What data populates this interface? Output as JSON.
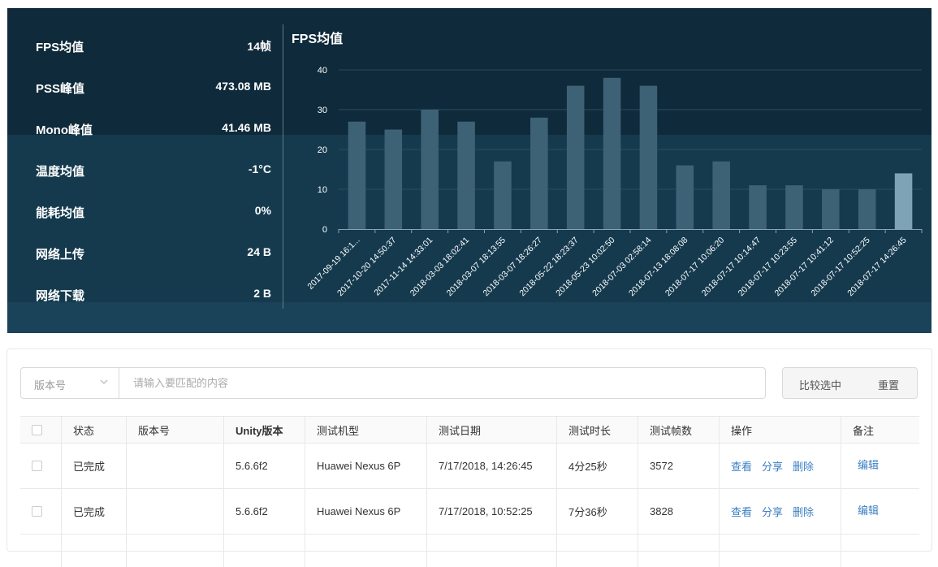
{
  "stats": [
    {
      "label": "FPS均值",
      "value": "14帧"
    },
    {
      "label": "PSS峰值",
      "value": "473.08 MB"
    },
    {
      "label": "Mono峰值",
      "value": "41.46 MB"
    },
    {
      "label": "温度均值",
      "value": "-1°C"
    },
    {
      "label": "能耗均值",
      "value": "0%"
    },
    {
      "label": "网络上传",
      "value": "24 B"
    },
    {
      "label": "网络下载",
      "value": "2 B"
    }
  ],
  "colors": {
    "bar": "#3e6275",
    "bar_selected": "#7fa3b6",
    "axis": "#8aa3b0"
  },
  "chart_data": {
    "type": "bar",
    "title": "FPS均值",
    "xlabel": "",
    "ylabel": "",
    "ylim": [
      0,
      40
    ],
    "yticks": [
      "0",
      "10",
      "20",
      "30",
      "40"
    ],
    "grid": true,
    "categories": [
      "2017-09-19 16:1...",
      "2017-10-20 14:50:37",
      "2017-11-14 14:33:01",
      "2018-03-03 18:02:41",
      "2018-03-07 18:13:55",
      "2018-03-07 18:26:27",
      "2018-05-22 18:23:37",
      "2018-05-23 10:02:50",
      "2018-07-03 02:58:14",
      "2018-07-13 18:08:08",
      "2018-07-17 10:06:20",
      "2018-07-17 10:14:47",
      "2018-07-17 10:23:55",
      "2018-07-17 10:41:12",
      "2018-07-17 10:52:25",
      "2018-07-17 14:26:45"
    ],
    "values": [
      27,
      25,
      30,
      27,
      17,
      28,
      36,
      38,
      36,
      16,
      17,
      11,
      11,
      10,
      10,
      14
    ],
    "highlighted_index": 15
  },
  "filter": {
    "select_value": "版本号",
    "search_placeholder": "请输入要匹配的内容",
    "compare_label": "比较选中",
    "reset_label": "重置"
  },
  "table": {
    "headers": [
      "状态",
      "版本号",
      "Unity版本",
      "测试机型",
      "测试日期",
      "测试时长",
      "测试帧数",
      "操作",
      "备注"
    ],
    "rows": [
      {
        "status": "已完成",
        "version": "",
        "unity": "5.6.6f2",
        "device": "Huawei Nexus 6P",
        "date": "7/17/2018, 14:26:45",
        "duration": "4分25秒",
        "frames": "3572",
        "op_view": "查看",
        "op_share": "分享",
        "op_delete": "删除",
        "note": "编辑"
      },
      {
        "status": "已完成",
        "version": "",
        "unity": "5.6.6f2",
        "device": "Huawei Nexus 6P",
        "date": "7/17/2018, 10:52:25",
        "duration": "7分36秒",
        "frames": "3828",
        "op_view": "查看",
        "op_share": "分享",
        "op_delete": "删除",
        "note": "编辑"
      }
    ]
  }
}
